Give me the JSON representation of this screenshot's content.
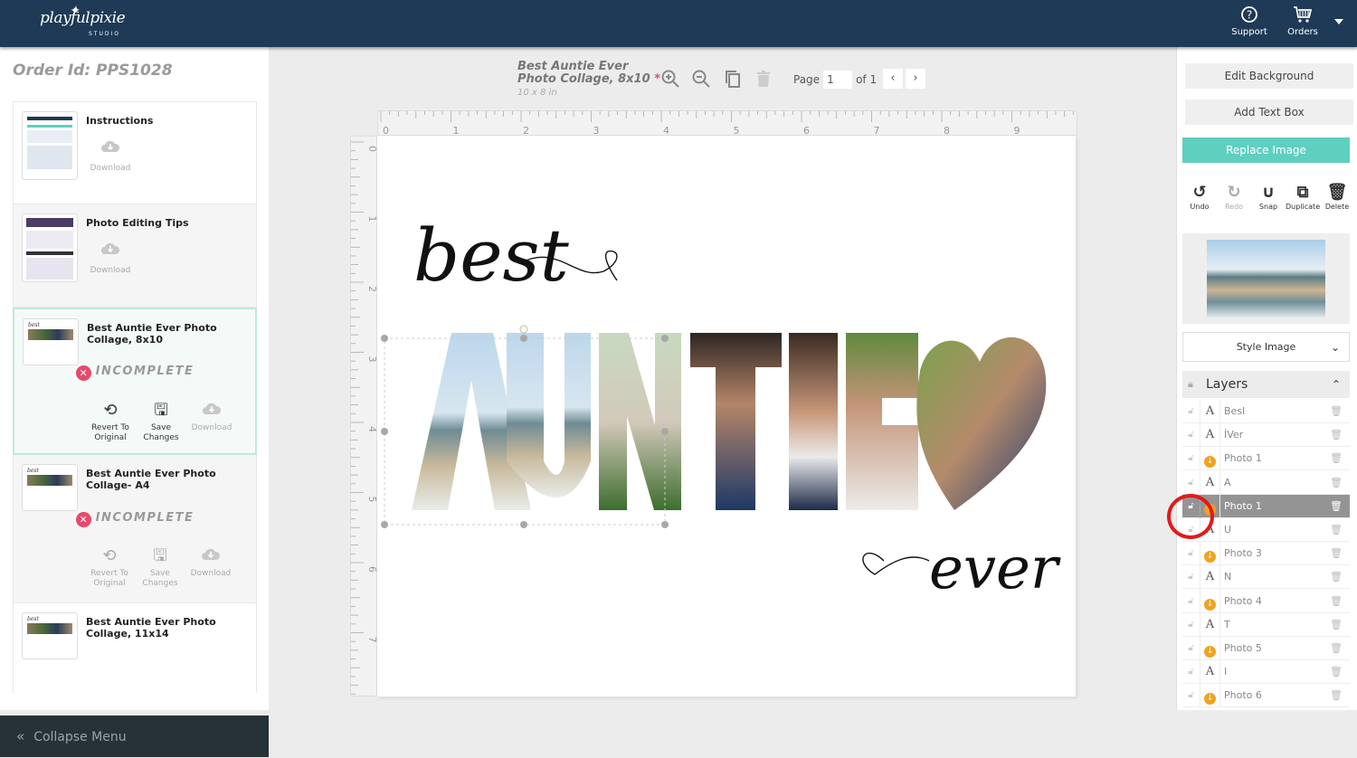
{
  "header": {
    "logo_text": "playfulpixie",
    "logo_sub": "STUDIO",
    "nav": [
      {
        "label": "Support",
        "icon": "question-circle-icon"
      },
      {
        "label": "Orders",
        "icon": "cart-icon"
      }
    ]
  },
  "sidebar": {
    "order_id": "Order Id: PPS1028",
    "items": [
      {
        "title": "Instructions",
        "download_label": "Download"
      },
      {
        "title": "Photo Editing Tips",
        "download_label": "Download"
      },
      {
        "title": "Best Auntie Ever Photo Collage, 8x10",
        "status": "INCOMPLETE",
        "revert_label": "Revert To Original",
        "save_label": "Save Changes",
        "download_label": "Download",
        "selected": true
      },
      {
        "title": "Best Auntie Ever Photo Collage- A4",
        "status": "INCOMPLETE",
        "revert_label": "Revert To Original",
        "save_label": "Save Changes",
        "download_label": "Download"
      },
      {
        "title": "Best Auntie Ever Photo Collage, 11x14"
      }
    ],
    "collapse_label": "Collapse Menu"
  },
  "editor": {
    "doc_title": "Best Auntie Ever Photo Collage, 8x10",
    "unsaved_marker": "*",
    "doc_size": "10 x 8 in",
    "page_label": "Page",
    "page_value": "1",
    "page_of": "of 1",
    "ruler_h": [
      "0",
      "1",
      "2",
      "3",
      "4",
      "5",
      "6",
      "7",
      "8",
      "9"
    ],
    "ruler_v": [
      "0",
      "1",
      "2",
      "3",
      "4",
      "5",
      "6",
      "7"
    ],
    "canvas": {
      "script_top": "best",
      "main_word": "AUNTIE",
      "script_bottom": "ever"
    }
  },
  "rightpanel": {
    "edit_background": "Edit Background",
    "add_text_box": "Add Text Box",
    "replace_image": "Replace Image",
    "tools": [
      {
        "label": "Undo",
        "icon": "undo-icon"
      },
      {
        "label": "Redo",
        "icon": "redo-icon",
        "disabled": true
      },
      {
        "label": "Snap",
        "icon": "magnet-icon"
      },
      {
        "label": "Duplicate",
        "icon": "duplicate-icon"
      },
      {
        "label": "Delete",
        "icon": "trash-icon"
      }
    ],
    "style_image": "Style Image",
    "layers_title": "Layers",
    "layers": [
      {
        "type": "text",
        "name": "BesI"
      },
      {
        "type": "text",
        "name": "İVer"
      },
      {
        "type": "photo",
        "name": "Photo 1"
      },
      {
        "type": "text",
        "name": "A"
      },
      {
        "type": "photo",
        "name": "Photo 1",
        "selected": true
      },
      {
        "type": "text",
        "name": "U"
      },
      {
        "type": "photo",
        "name": "Photo 3"
      },
      {
        "type": "text",
        "name": "N"
      },
      {
        "type": "photo",
        "name": "Photo 4"
      },
      {
        "type": "text",
        "name": "T"
      },
      {
        "type": "photo",
        "name": "Photo 5"
      },
      {
        "type": "text",
        "name": "I"
      },
      {
        "type": "photo",
        "name": "Photo 6"
      }
    ],
    "accent_color": "#5fcfc0",
    "highlight_color": "#e01b1b"
  }
}
